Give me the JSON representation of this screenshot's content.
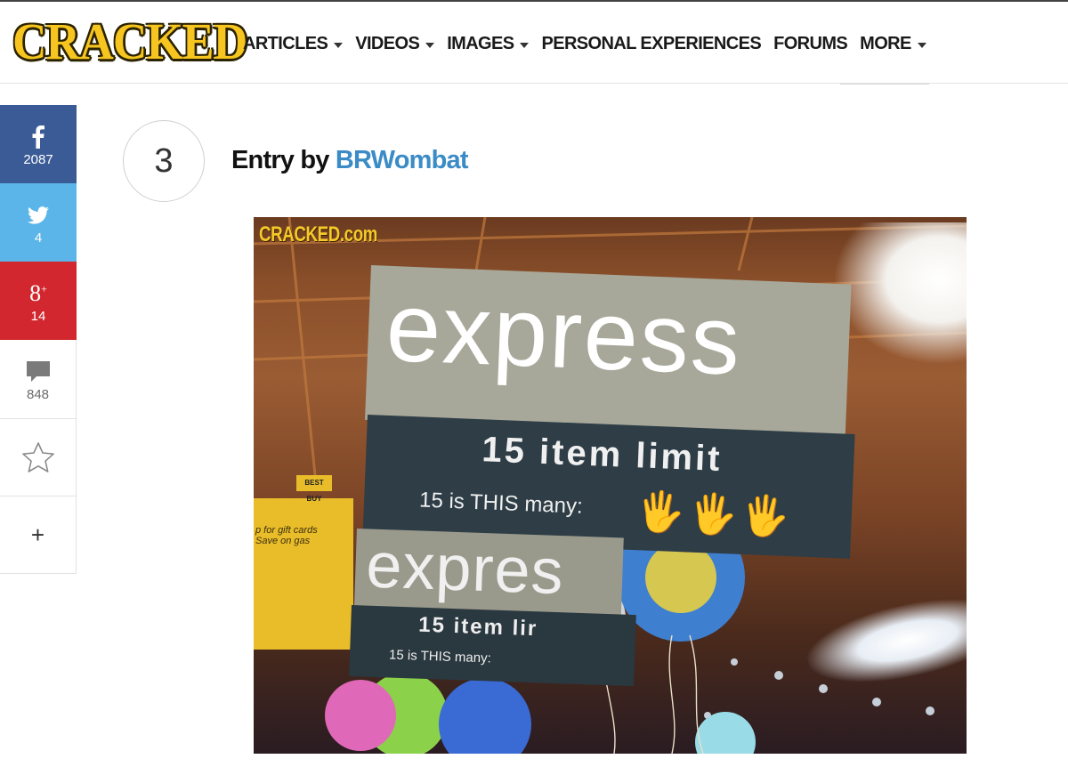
{
  "header": {
    "logo": "CRACKED",
    "nav": [
      {
        "label": "ARTICLES",
        "dropdown": true
      },
      {
        "label": "VIDEOS",
        "dropdown": true
      },
      {
        "label": "IMAGES",
        "dropdown": true
      },
      {
        "label": "PERSONAL EXPERIENCES",
        "dropdown": false
      },
      {
        "label": "FORUMS",
        "dropdown": false
      },
      {
        "label": "MORE",
        "dropdown": true
      }
    ]
  },
  "share": {
    "facebook": {
      "icon": "facebook-icon",
      "count": "2087",
      "color": "#3b5b96"
    },
    "twitter": {
      "icon": "twitter-bird-icon",
      "count": "4",
      "color": "#5cb5e9"
    },
    "googleplus": {
      "icon": "google-plus-icon",
      "label": "g+",
      "count": "14",
      "color": "#d2272e"
    },
    "comments": {
      "icon": "comment-bubble-icon",
      "count": "848"
    },
    "favorite": {
      "icon": "star-icon"
    },
    "more": {
      "icon": "plus-icon",
      "label": "+"
    }
  },
  "entry": {
    "rank": "3",
    "title_prefix": "Entry by ",
    "author": "BRWombat"
  },
  "image": {
    "watermark": "CRACKED.com",
    "sign_main": "express",
    "sign_line1": "15 item limit",
    "sign_line2": "15 is THIS many:",
    "sign_hands": "🖐🖐🖐",
    "sign2_main": "expres",
    "sign2_line1": "15 item lir",
    "sign2_line2": "15 is THIS many:",
    "ad_text": "p for gift cards\nSave on gas",
    "ad_brand": "BEST BUY"
  }
}
